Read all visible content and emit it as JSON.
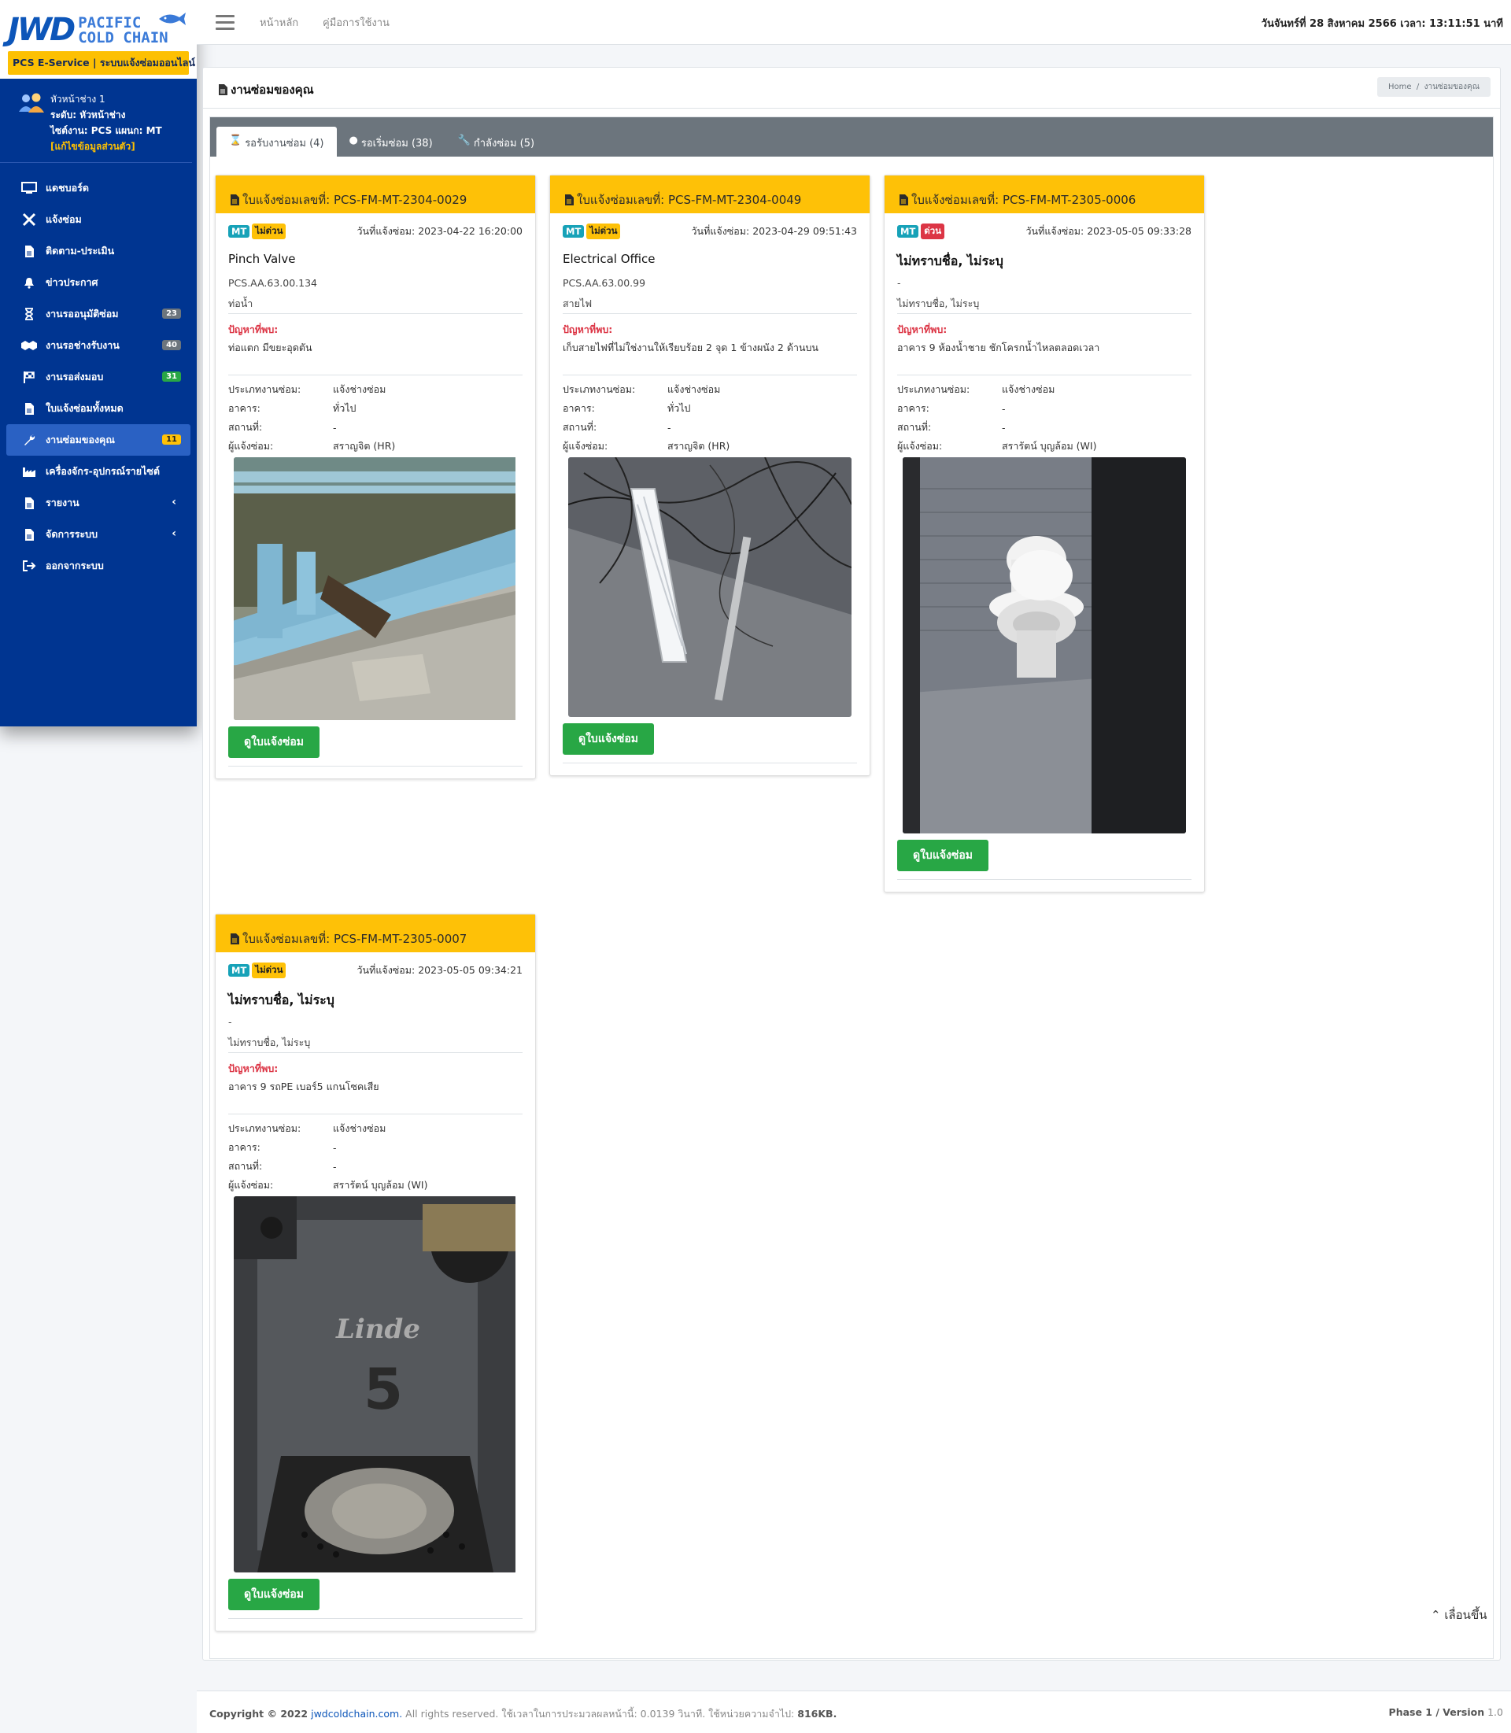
{
  "brand": {
    "logo_main": "JWD",
    "logo_line1": "PACIFIC",
    "logo_line2": "COLD CHAIN",
    "service_banner": "PCS E-Service | ระบบแจ้งซ่อมออนไลน์"
  },
  "user": {
    "name": "หัวหน้าช่าง 1",
    "level": "ระดับ: หัวหน้าช่าง",
    "site": "ไซต์งาน: PCS แผนก: MT",
    "edit": "[แก้ไขข้อมูลส่วนตัว]"
  },
  "sidebar": {
    "items": [
      {
        "label": "แดชบอร์ด",
        "icon": "monitor-icon"
      },
      {
        "label": "แจ้งซ่อม",
        "icon": "tools-icon"
      },
      {
        "label": "ติดตาม-ประเมิน",
        "icon": "document-icon"
      },
      {
        "label": "ข่าวประกาศ",
        "icon": "bell-icon"
      },
      {
        "label": "งานรออนุมัติซ่อม",
        "icon": "hourglass-icon",
        "badge": "23",
        "badge_color": "#6c757d"
      },
      {
        "label": "งานรอช่างรับงาน",
        "icon": "handshake-icon",
        "badge": "40",
        "badge_color": "#6c757d"
      },
      {
        "label": "งานรอส่งมอบ",
        "icon": "flag-icon",
        "badge": "31",
        "badge_color": "#28a745"
      },
      {
        "label": "ใบแจ้งซ่อมทั้งหมด",
        "icon": "document-icon"
      },
      {
        "label": "งานซ่อมของคุณ",
        "icon": "wrench-icon",
        "badge": "11",
        "badge_color": "#fec107"
      },
      {
        "label": "เครื่องจักร-อุปกรณ์รายไซต์",
        "icon": "factory-icon"
      },
      {
        "label": "รายงาน",
        "icon": "document-icon",
        "arrow": "‹"
      },
      {
        "label": "จัดการระบบ",
        "icon": "document-icon",
        "arrow": "‹"
      },
      {
        "label": "ออกจากระบบ",
        "icon": "logout-icon"
      }
    ]
  },
  "topbar": {
    "link_home": "หน้าหลัก",
    "link_manual": "คู่มือการใช้งาน",
    "datetime": "วันจันทร์ที่ 28 สิงหาคม 2566 เวลา: 13:11:51 นาที"
  },
  "page": {
    "title": "งานซ่อมของคุณ",
    "breadcrumb_home": "Home",
    "breadcrumb_sep": "/",
    "breadcrumb_current": "งานซ่อมของคุณ"
  },
  "tabs": [
    {
      "label": "รอรับงานซ่อม (4)"
    },
    {
      "label": "รอเริ่มซ่อม (38)"
    },
    {
      "label": "กำลังซ่อม (5)"
    }
  ],
  "labels": {
    "doc_no": "ใบแจ้งซ่อมเลขที่:",
    "date": "วันที่แจ้งซ่อม:",
    "problem": "ปัญหาที่พบ:",
    "work_type": "ประเภทงานซ่อม:",
    "building": "อาคาร:",
    "location": "สถานที่:",
    "reporter": "ผู้แจ้งซ่อม:",
    "view_button": "ดูใบแจ้งซ่อม"
  },
  "cards": [
    {
      "doc_no": "PCS-FM-MT-2304-0029",
      "dept": "MT",
      "priority": "ไม่ด่วน",
      "priority_class": "normal",
      "date": "2023-04-22 16:20:00",
      "asset_name": "Pinch Valve",
      "asset_code": "PCS.AA.63.00.134",
      "asset_sub": "ท่อน้ำ",
      "problem": "ท่อแตก มีขยะอุดตัน",
      "work_type": "แจ้งช่างซ่อม",
      "building": "ทั่วไป",
      "location": "-",
      "reporter": "สราญจิต (HR)"
    },
    {
      "doc_no": "PCS-FM-MT-2304-0049",
      "dept": "MT",
      "priority": "ไม่ด่วน",
      "priority_class": "normal",
      "date": "2023-04-29 09:51:43",
      "asset_name": "Electrical Office",
      "asset_code": "PCS.AA.63.00.99",
      "asset_sub": "สายไฟ",
      "problem": "เก็บสายไฟที่ไม่ใช่งานให้เรียบร้อย 2 จุด 1 ข้างผนัง 2 ด้านบน",
      "work_type": "แจ้งช่างซ่อม",
      "building": "ทั่วไป",
      "location": "-",
      "reporter": "สราญจิต (HR)"
    },
    {
      "doc_no": "PCS-FM-MT-2305-0006",
      "dept": "MT",
      "priority": "ด่วน",
      "priority_class": "urgent",
      "date": "2023-05-05 09:33:28",
      "asset_name": "ไม่ทราบชื่อ, ไม่ระบุ",
      "asset_code": "-",
      "asset_sub": "ไม่ทราบชื่อ, ไม่ระบุ",
      "problem": "อาคาร 9 ห้องน้ำชาย ชักโครกน้ำไหลตลอดเวลา",
      "work_type": "แจ้งช่างซ่อม",
      "building": "-",
      "location": "-",
      "reporter": "สรารัตน์ บุญล้อม (WI)"
    },
    {
      "doc_no": "PCS-FM-MT-2305-0007",
      "dept": "MT",
      "priority": "ไม่ด่วน",
      "priority_class": "normal",
      "date": "2023-05-05 09:34:21",
      "asset_name": "ไม่ทราบชื่อ, ไม่ระบุ",
      "asset_code": "-",
      "asset_sub": "ไม่ทราบชื่อ, ไม่ระบุ",
      "problem": "อาคาร 9 รถPE เบอร์5 แกนโซคเสีย",
      "work_type": "แจ้งช่างซ่อม",
      "building": "-",
      "location": "-",
      "reporter": "สรารัตน์ บุญล้อม (WI)",
      "photo_text_brand": "Linde",
      "photo_text_number": "5"
    }
  ],
  "scroll_top": "เลื่อนขึ้น",
  "footer": {
    "copyright": "Copyright © 2022",
    "site": "jwdcoldchain.com.",
    "rights": "All rights reserved. ใช้เวลาในการประมวลผลหน้านี้: 0.0139 วินาที. ใช้หน่วยความจำไป:",
    "memory": "816KB.",
    "phase": "Phase 1 / Version",
    "version": "1.0"
  }
}
